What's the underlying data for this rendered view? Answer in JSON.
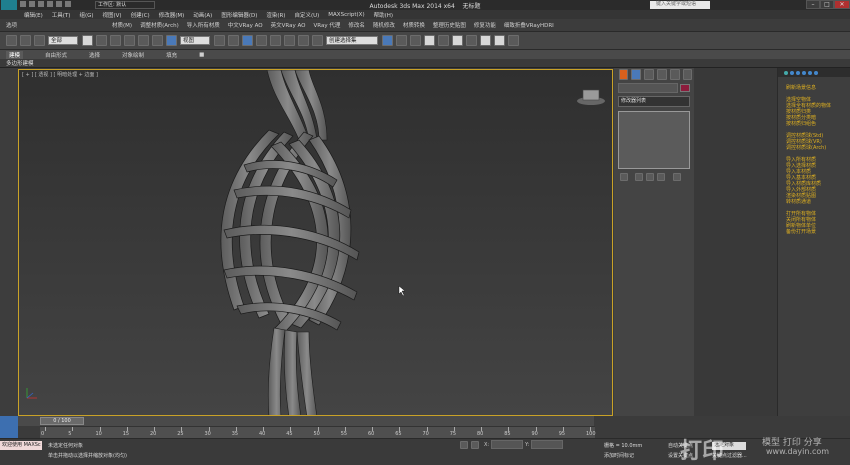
{
  "app": {
    "title": "Autodesk 3ds Max  2014 x64",
    "doc_title": "无标题",
    "workspace_label": "工作区: 默认",
    "search_placeholder": "键入关键字或短语"
  },
  "menus": {
    "row1": [
      "编辑(E)",
      "工具(T)",
      "组(G)",
      "视图(V)",
      "创建(C)",
      "修改器(M)",
      "动画(A)",
      "图形编辑器(D)",
      "渲染(R)",
      "自定义(U)",
      "MAXScript(X)",
      "帮助(H)"
    ],
    "row2": [
      "选项",
      "材质(M)",
      "调整材质(Arch)",
      "导入所有材质",
      "中文VRay AO",
      "英文VRay AO",
      "VRay 代理",
      "修改名",
      "随机修改",
      "材质转换",
      "整理历史贴图",
      "修复功能",
      "细致折叠VRayHDRI"
    ]
  },
  "toolbar": {
    "selection_filter": "全部",
    "ref_coord": "视图",
    "named_selection": "创建选择集"
  },
  "ribbon": {
    "tabs": [
      "建模",
      "自由形式",
      "选择",
      "对象绘制",
      "填充",
      "■"
    ],
    "sub_label": "多边形建模"
  },
  "viewport": {
    "label": "[ + ] [ 透视 ] [ 明暗处理 + 边面 ]"
  },
  "command_panel": {
    "list_label": "修改器列表",
    "name_value": ""
  },
  "right_panel": {
    "groups": [
      [
        "刷新场景信息"
      ],
      [
        "选择空物体",
        "选择全有材质的物体",
        "按材质归类",
        "按材质分类暗",
        "按材质归组色"
      ],
      [
        "调控材质球(Std)",
        "调控材质球(VR)",
        "调控材质球(Arch)"
      ],
      [
        "导入所有材质",
        "导入选择材质",
        "导入本材质",
        "导入基本材质",
        "导入材质库材质",
        "导入外部材质",
        "渲染材质贴图",
        "转材质通道"
      ],
      [
        "打开所有物体",
        "关闭所有物体",
        "刷新物体单位",
        "备份打开场景"
      ]
    ]
  },
  "timeline": {
    "frame_counter": "0 / 100",
    "ticks": [
      "0",
      "5",
      "10",
      "15",
      "20",
      "25",
      "30",
      "35",
      "40",
      "45",
      "50",
      "55",
      "60",
      "65",
      "70",
      "75",
      "80",
      "85",
      "90",
      "95",
      "100"
    ]
  },
  "status": {
    "maxscript_label": "欢迎使用 MAXSc",
    "line1": "未选定任何对象",
    "line2": "单击并拖动以选择并缩放对象(均匀)",
    "grid": "栅格 = 10.0mm",
    "add_time_tag": "添加时间标记",
    "auto_key": "自动关键点",
    "set_key": "设置关键点",
    "selected": "选定对象",
    "key_filter": "关键点过滤器..."
  },
  "watermark": {
    "brand": "打印",
    "site": "模型 打印 分享",
    "url": "www.dayin.com"
  },
  "colors": {
    "viewport_border": "#c9a227",
    "link": "#dfb020"
  }
}
